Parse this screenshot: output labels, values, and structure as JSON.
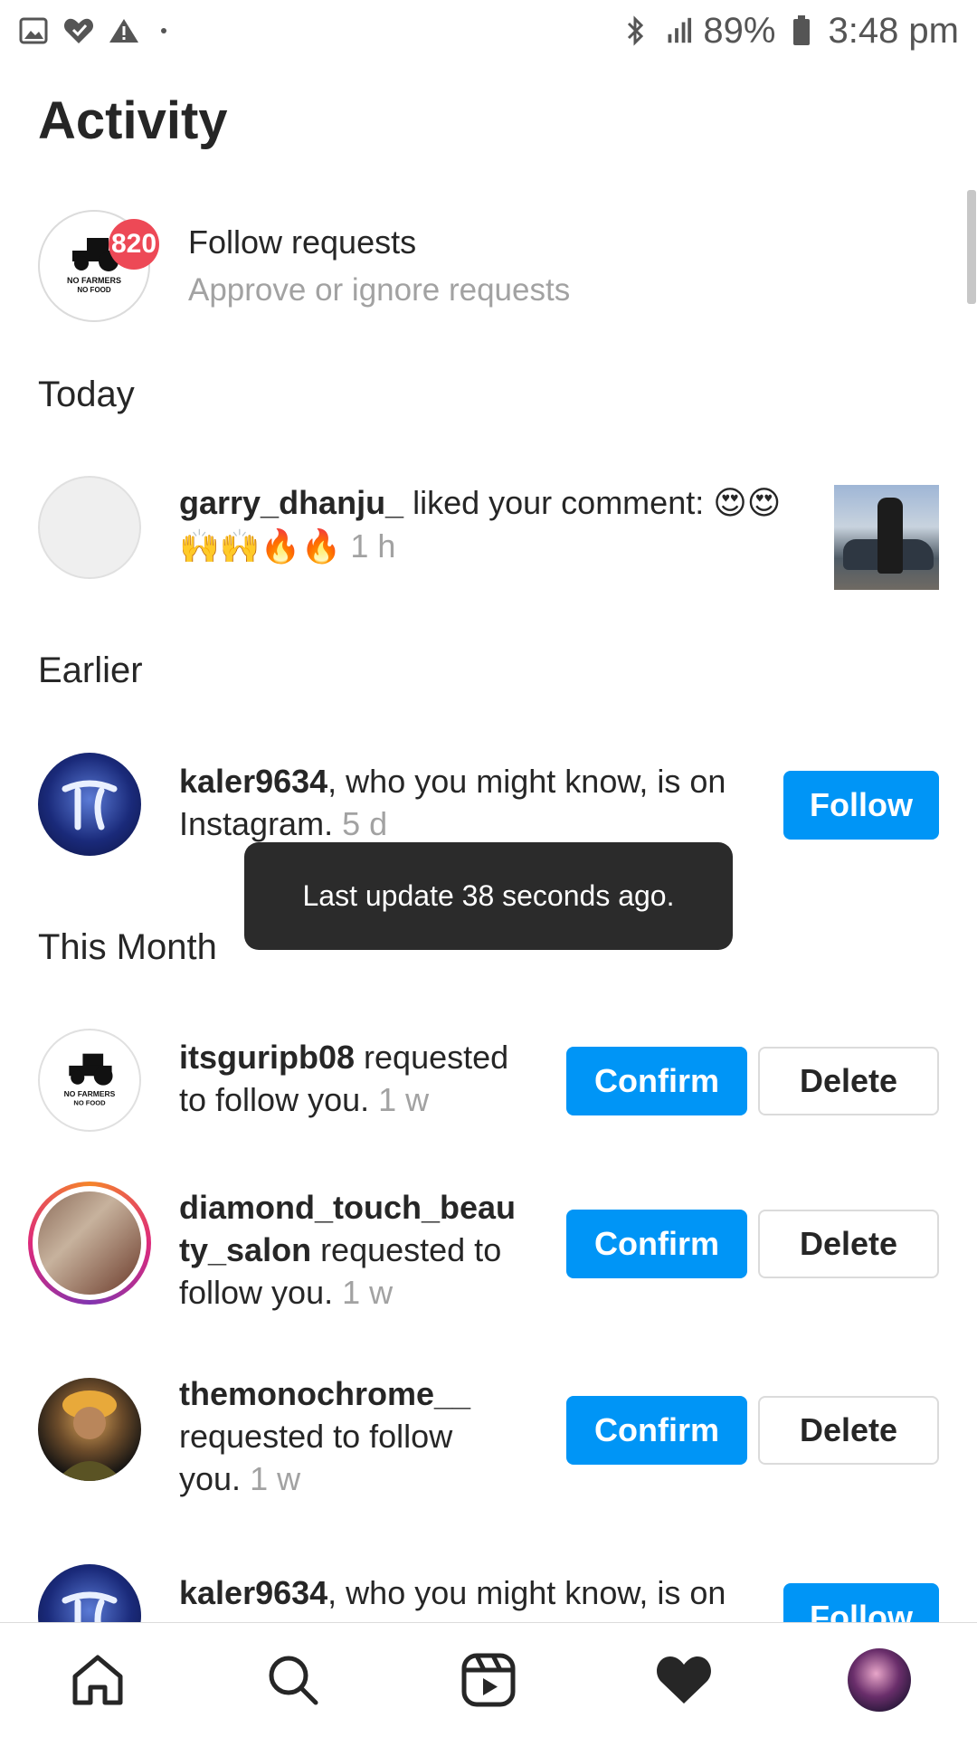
{
  "status_bar": {
    "battery": "89%",
    "time": "3:48 pm"
  },
  "page": {
    "title": "Activity"
  },
  "follow_requests": {
    "badge_count": "820",
    "title": "Follow requests",
    "subtitle": "Approve or ignore requests",
    "avatar_text": [
      "NO FARMERS",
      "NO FOOD"
    ]
  },
  "sections": {
    "today": "Today",
    "earlier": "Earlier",
    "this_month": "This Month"
  },
  "today_item": {
    "username": "garry_dhanju_",
    "text": " liked your comment: ",
    "emojis_line1": "😍😍",
    "emojis_line2": "🙌🙌🔥🔥",
    "time": "1 h"
  },
  "earlier_item": {
    "username": "kaler9634",
    "text_line1": ", who you might know, is on",
    "text_line2": "Instagram.",
    "time": "5 d",
    "button": "Follow"
  },
  "toast": "Last update 38 seconds ago.",
  "requests": [
    {
      "username": "itsguripb08",
      "text_a": " requested",
      "text_b": "to follow you.",
      "time": "1 w"
    },
    {
      "username_a": "diamond_touch_beau",
      "username_b": "ty_salon",
      "text_a": " requested to",
      "text_b": "follow you.",
      "time": "1 w"
    },
    {
      "username": "themonochrome__",
      "text_a": "requested to follow",
      "text_b": "you.",
      "time": "1 w"
    }
  ],
  "buttons": {
    "confirm": "Confirm",
    "delete": "Delete"
  },
  "last_item": {
    "username": "kaler9634",
    "text": ", who you might know, is on",
    "button": "Follow"
  },
  "colors": {
    "accent": "#0095f6",
    "badge": "#ed4956",
    "muted": "#a2a2a2"
  }
}
